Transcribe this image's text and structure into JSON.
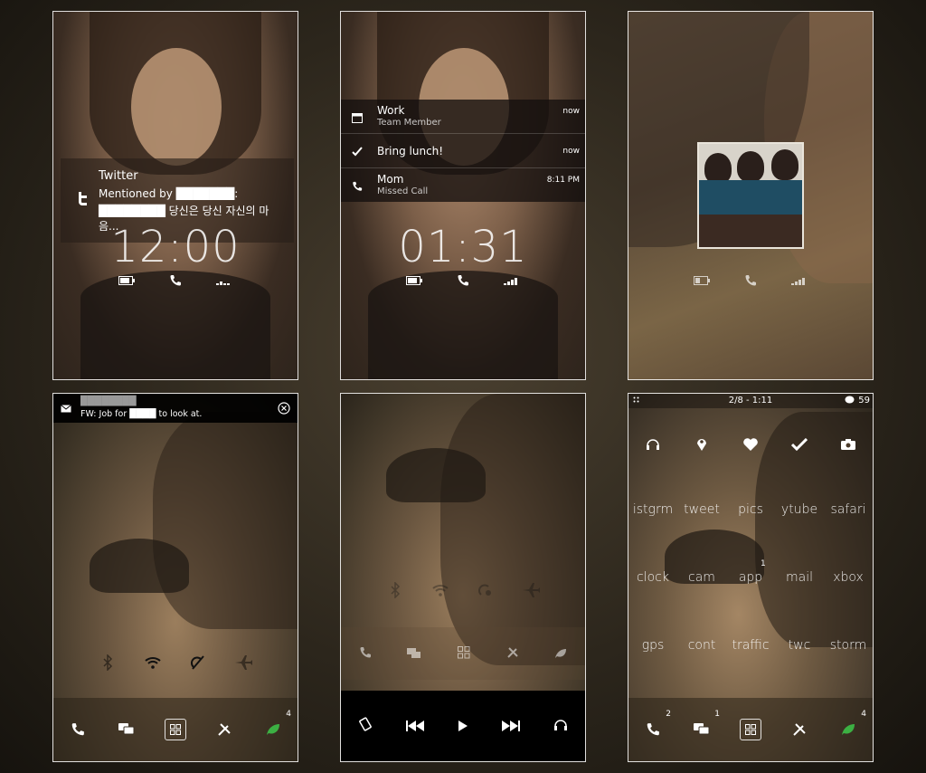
{
  "panel1": {
    "notification": {
      "app": "Twitter",
      "line1": "Mentioned by ███████:",
      "line2": "████████ 당신은 당신 자신의 마",
      "line3": "음..."
    },
    "clock": "12:00"
  },
  "panel2": {
    "notifications": [
      {
        "title": "Work",
        "subtitle": "Team Member",
        "time": "now",
        "icon": "calendar-icon"
      },
      {
        "title": "Bring lunch!",
        "subtitle": "",
        "time": "now",
        "icon": "check-icon"
      },
      {
        "title": "Mom",
        "subtitle": "Missed Call",
        "time": "8:11 PM",
        "icon": "phone-icon"
      }
    ],
    "clock": "01:31"
  },
  "panel4": {
    "email": {
      "sender": "████████",
      "subject": "FW: Job for ████ to look at."
    },
    "dock_badge": "4"
  },
  "panel6": {
    "status": "2/8 - 1:11",
    "status_count": "59",
    "apps": [
      "istgrm",
      "tweet",
      "pics",
      "ytube",
      "safari",
      "clock",
      "cam",
      "app",
      "mail",
      "xbox",
      "gps",
      "cont",
      "traffic",
      "twc",
      "storm"
    ],
    "app_badge": "1",
    "dock_badges": {
      "phone": "2",
      "messages": "1",
      "leaf": "4"
    }
  },
  "colors": {
    "accent_green": "#3cb043",
    "dark_bar": "#000000"
  }
}
